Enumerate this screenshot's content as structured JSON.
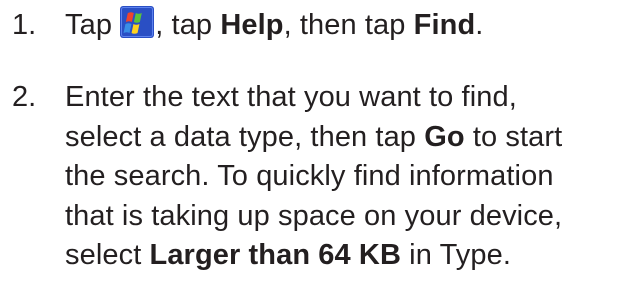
{
  "steps": [
    {
      "number": "1.",
      "tap_word": "Tap",
      "icon": "windows-start-icon",
      "after_icon": ", tap ",
      "help": "Help",
      "then_tap": ", then tap ",
      "find": "Find",
      "period": "."
    },
    {
      "number": "2.",
      "line1": "Enter the text that you want to find,",
      "line2_pre": "select a data type, then tap ",
      "go": "Go",
      "line2_post": " to start",
      "line3": "the search. To quickly find information",
      "line4": "that is taking up space on your device,",
      "line5_pre": "select ",
      "larger": "Larger than 64 KB",
      "line5_post": " in Type."
    }
  ],
  "colors": {
    "text": "#231f20",
    "icon_bg": "#2a4fc4",
    "flag_red": "#f0442c",
    "flag_green": "#5cc33a",
    "flag_blue": "#3a8ee6",
    "flag_yellow": "#ffd21f"
  }
}
